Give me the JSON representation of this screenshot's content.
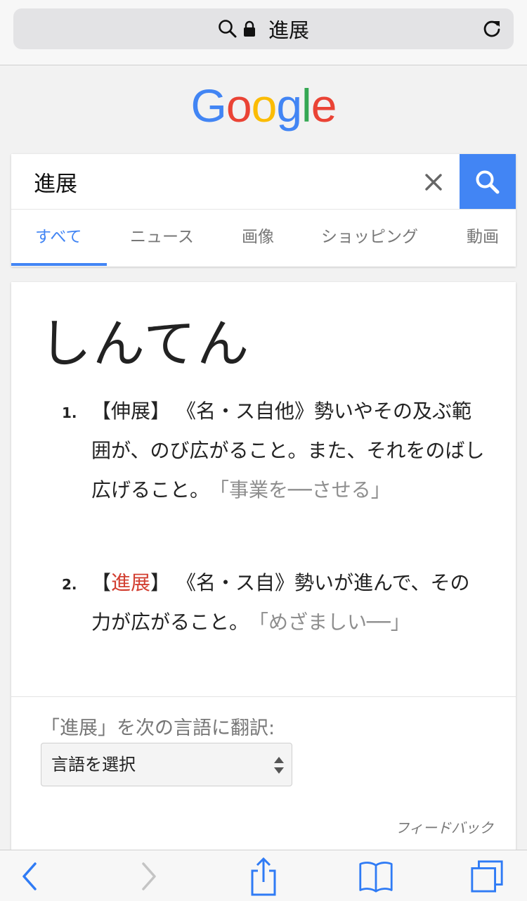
{
  "urlbar": {
    "text": "進展"
  },
  "logo": {
    "letters": [
      "G",
      "o",
      "o",
      "g",
      "l",
      "e"
    ],
    "colors": [
      "#4285f4",
      "#ea4335",
      "#fbbc05",
      "#4285f4",
      "#34a853",
      "#ea4335"
    ]
  },
  "search": {
    "query": "進展"
  },
  "tabs": [
    "すべて",
    "ニュース",
    "画像",
    "ショッピング",
    "動画"
  ],
  "dictionary": {
    "reading": "しんてん",
    "definitions": [
      {
        "number": "1.",
        "open": "【",
        "kanji": "伸展",
        "close": "】",
        "pos": "《名・ス自他》",
        "text": "勢いやその及ぶ範囲が、のび広がること。また、それをのばし広げること。",
        "example": "「事業を──させる」"
      },
      {
        "number": "2.",
        "open": "【",
        "kanji": "進展",
        "close": "】",
        "pos": "《名・ス自》",
        "text": "勢いが進んで、その力が広がること。",
        "example": "「めざましい──」"
      }
    ],
    "translate_label": "「進展」を次の言語に翻訳:",
    "language_select": "言語を選択",
    "feedback": "フィードバック"
  },
  "colors": {
    "accent": "#4285f4",
    "kanji_red": "#d23f31",
    "ios_blue": "#2f7bf5"
  }
}
